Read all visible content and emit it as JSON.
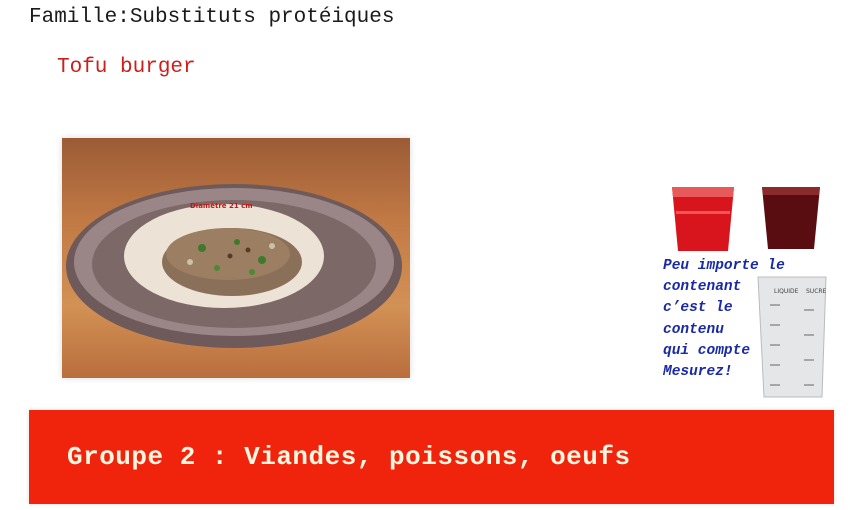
{
  "header": {
    "family": "Famille:Substituts protéiques",
    "dish": "Tofu burger"
  },
  "photo": {
    "plate_label": "Diamètre 21 cm"
  },
  "tip": {
    "lines": [
      "Peu importe le",
      "contenant",
      "c’est le",
      "contenu",
      "qui compte",
      "Mesurez!"
    ],
    "cup_labels": {
      "left": "LIQUIDE",
      "right": "SUCRE"
    }
  },
  "banner": {
    "group": "Groupe 2 : Viandes, poissons, oeufs"
  },
  "colors": {
    "dish_title": "#cc1f1a",
    "tip_text": "#1a2aa6",
    "banner_bg": "#f0230c",
    "banner_text": "#fff6e0"
  }
}
